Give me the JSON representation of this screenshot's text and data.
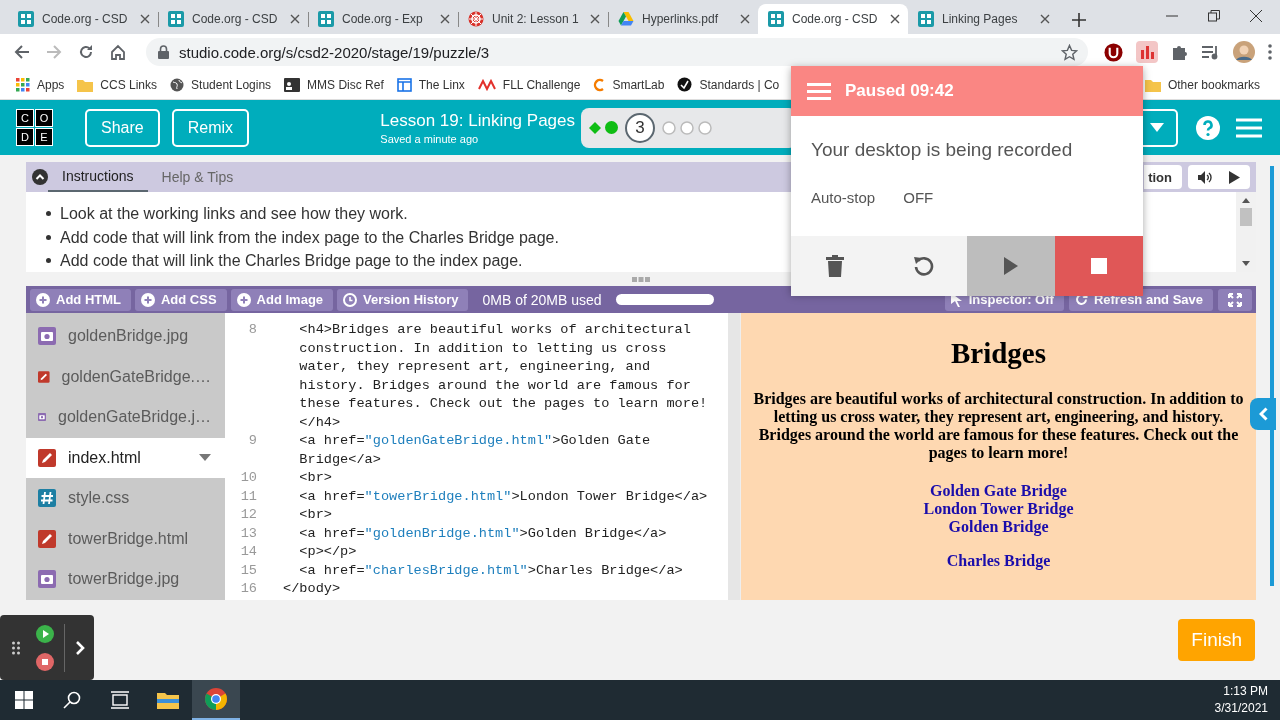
{
  "browser": {
    "tabs": [
      {
        "title": "Code.org - CSD",
        "kind": "codeorg",
        "selected": false
      },
      {
        "title": "Code.org - CSD",
        "kind": "codeorg",
        "selected": false
      },
      {
        "title": "Code.org - Exp",
        "kind": "codeorg",
        "selected": false
      },
      {
        "title": "Unit 2: Lesson 1",
        "kind": "wheel",
        "selected": false
      },
      {
        "title": "Hyperlinks.pdf",
        "kind": "drive",
        "selected": false
      },
      {
        "title": "Code.org - CSD",
        "kind": "codeorg",
        "selected": true
      },
      {
        "title": "Linking Pages",
        "kind": "codeorg",
        "selected": false
      }
    ],
    "url": "studio.code.org/s/csd2-2020/stage/19/puzzle/3",
    "bookmarks": [
      {
        "label": "Apps",
        "kind": "apps"
      },
      {
        "label": "CCS Links",
        "kind": "folder"
      },
      {
        "label": "Student Logins",
        "kind": "globe"
      },
      {
        "label": "MMS Disc Ref",
        "kind": "card"
      },
      {
        "label": "The Linx",
        "kind": "window"
      },
      {
        "label": "FLL Challenge",
        "kind": "fll"
      },
      {
        "label": "SmartLab",
        "kind": "smart"
      },
      {
        "label": "Standards | Co",
        "kind": "standards"
      }
    ],
    "other_bookmarks": "Other bookmarks"
  },
  "header": {
    "logo": [
      "C",
      "O",
      "D",
      "E"
    ],
    "buttons": [
      "Share",
      "Remix"
    ],
    "lesson_title": "Lesson 19: Linking Pages",
    "save_status": "Saved a minute ago",
    "progress": [
      {
        "kind": "diamond"
      },
      {
        "kind": "dot"
      },
      {
        "kind": "current",
        "label": "3"
      },
      {
        "kind": "empty"
      },
      {
        "kind": "empty"
      },
      {
        "kind": "empty"
      }
    ]
  },
  "instructions": {
    "tabs": [
      {
        "label": "Instructions",
        "selected": true
      },
      {
        "label": "Help & Tips",
        "selected": false
      }
    ],
    "collapse_label": "tion",
    "bullets": [
      "Look at the working links and see how they work.",
      "Add code that will link from the index page to the Charles Bridge page.",
      "Add code that will link the Charles Bridge page to the index page."
    ]
  },
  "toolbar": {
    "buttons": [
      {
        "label": "Add HTML",
        "kind": "plus"
      },
      {
        "label": "Add CSS",
        "kind": "plus"
      },
      {
        "label": "Add Image",
        "kind": "plus"
      },
      {
        "label": "Version History",
        "kind": "clock"
      }
    ],
    "storage": "0MB of 20MB used",
    "right_buttons": [
      {
        "label": "Inspector: Off",
        "kind": "pointer"
      },
      {
        "label": "Refresh and Save",
        "kind": "refresh"
      }
    ]
  },
  "files": [
    {
      "name": "goldenBridge.jpg",
      "kind": "image",
      "selected": false
    },
    {
      "name": "goldenGateBridge.…",
      "kind": "html",
      "selected": false
    },
    {
      "name": "goldenGateBridge.j…",
      "kind": "image",
      "selected": false
    },
    {
      "name": "index.html",
      "kind": "html",
      "selected": true
    },
    {
      "name": "style.css",
      "kind": "css",
      "selected": false
    },
    {
      "name": "towerBridge.html",
      "kind": "html",
      "selected": false
    },
    {
      "name": "towerBridge.jpg",
      "kind": "image",
      "selected": false
    }
  ],
  "code": [
    {
      "number": "8",
      "segments": [
        {
          "kind": "plain",
          "text": "  <h4>Bridges are beautiful works of architectural construction. In addition to letting us cross water, they represent art, engineering, and history. Bridges around the world are famous for these features. Check out the pages to learn more! </h4>"
        }
      ]
    },
    {
      "number": "9",
      "segments": [
        {
          "kind": "plain",
          "text": "  <a href="
        },
        {
          "kind": "string",
          "text": "\"goldenGateBridge.html\""
        },
        {
          "kind": "plain",
          "text": ">Golden Gate Bridge</a>"
        }
      ]
    },
    {
      "number": "10",
      "segments": [
        {
          "kind": "plain",
          "text": "  <br>"
        }
      ]
    },
    {
      "number": "11",
      "segments": [
        {
          "kind": "plain",
          "text": "  <a href="
        },
        {
          "kind": "string",
          "text": "\"towerBridge.html\""
        },
        {
          "kind": "plain",
          "text": ">London Tower Bridge</a>"
        }
      ]
    },
    {
      "number": "12",
      "segments": [
        {
          "kind": "plain",
          "text": "  <br>"
        }
      ]
    },
    {
      "number": "13",
      "segments": [
        {
          "kind": "plain",
          "text": "  <a href="
        },
        {
          "kind": "string",
          "text": "\"goldenBridge.html\""
        },
        {
          "kind": "plain",
          "text": ">Golden Bridge</a>"
        }
      ]
    },
    {
      "number": "14",
      "segments": [
        {
          "kind": "plain",
          "text": "  <p></p>"
        }
      ]
    },
    {
      "number": "15",
      "segments": [
        {
          "kind": "plain",
          "text": "  <a href="
        },
        {
          "kind": "string",
          "text": "\"charlesBridge.html\""
        },
        {
          "kind": "plain",
          "text": ">Charles Bridge</a>"
        }
      ]
    },
    {
      "number": "16",
      "segments": [
        {
          "kind": "plain",
          "text": "</body>"
        }
      ]
    }
  ],
  "preview": {
    "heading": "Bridges",
    "paragraph": "Bridges are beautiful works of architectural construction. In addition to letting us cross water, they represent art, engineering, and history. Bridges around the world are famous for these features. Check out the pages to learn more!",
    "link_groups": [
      [
        "Golden Gate Bridge",
        "London Tower Bridge",
        "Golden Bridge"
      ],
      [
        "Charles Bridge"
      ]
    ]
  },
  "finish": "Finish",
  "recorder": {
    "status": "Paused 09:42",
    "message": "Your desktop is being recorded",
    "auto_stop_label": "Auto-stop",
    "auto_stop_value": "OFF",
    "controls": [
      {
        "kind": "delete",
        "hovered": false
      },
      {
        "kind": "restart",
        "hovered": false
      },
      {
        "kind": "play",
        "hovered": true
      },
      {
        "kind": "stop",
        "hovered": false
      }
    ]
  },
  "taskbar": {
    "apps": [
      {
        "kind": "explorer",
        "active": false
      },
      {
        "kind": "chrome",
        "active": true
      }
    ],
    "time": "1:13 PM",
    "date": "3/31/2021"
  }
}
